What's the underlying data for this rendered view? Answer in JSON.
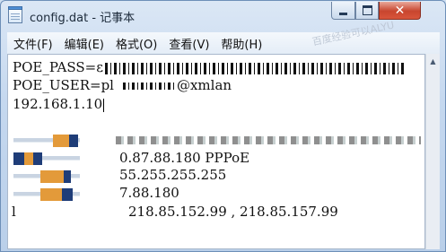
{
  "window": {
    "title": "config.dat - 记事本",
    "close_glyph": "✕"
  },
  "menubar": {
    "items": [
      {
        "label": "文件(F)"
      },
      {
        "label": "编辑(E)"
      },
      {
        "label": "格式(O)"
      },
      {
        "label": "查看(V)"
      },
      {
        "label": "帮助(H)"
      }
    ],
    "watermark": "百度经验可以ALYU"
  },
  "editor": {
    "lines": [
      "POE_PASS=ε",
      "POE_USER=pl",
      "@xmlan",
      "192.168.1.10",
      "0.87.88.180 PPPoE",
      "55.255.255.255",
      "7.88.180",
      "218.85.152.99 , 218.85.157.99",
      "l"
    ]
  },
  "icons": {
    "app": "notepad-icon",
    "minimize": "minimize-icon",
    "maximize": "maximize-icon",
    "close": "close-icon",
    "scroll_up": "scroll-up-arrow-icon"
  }
}
